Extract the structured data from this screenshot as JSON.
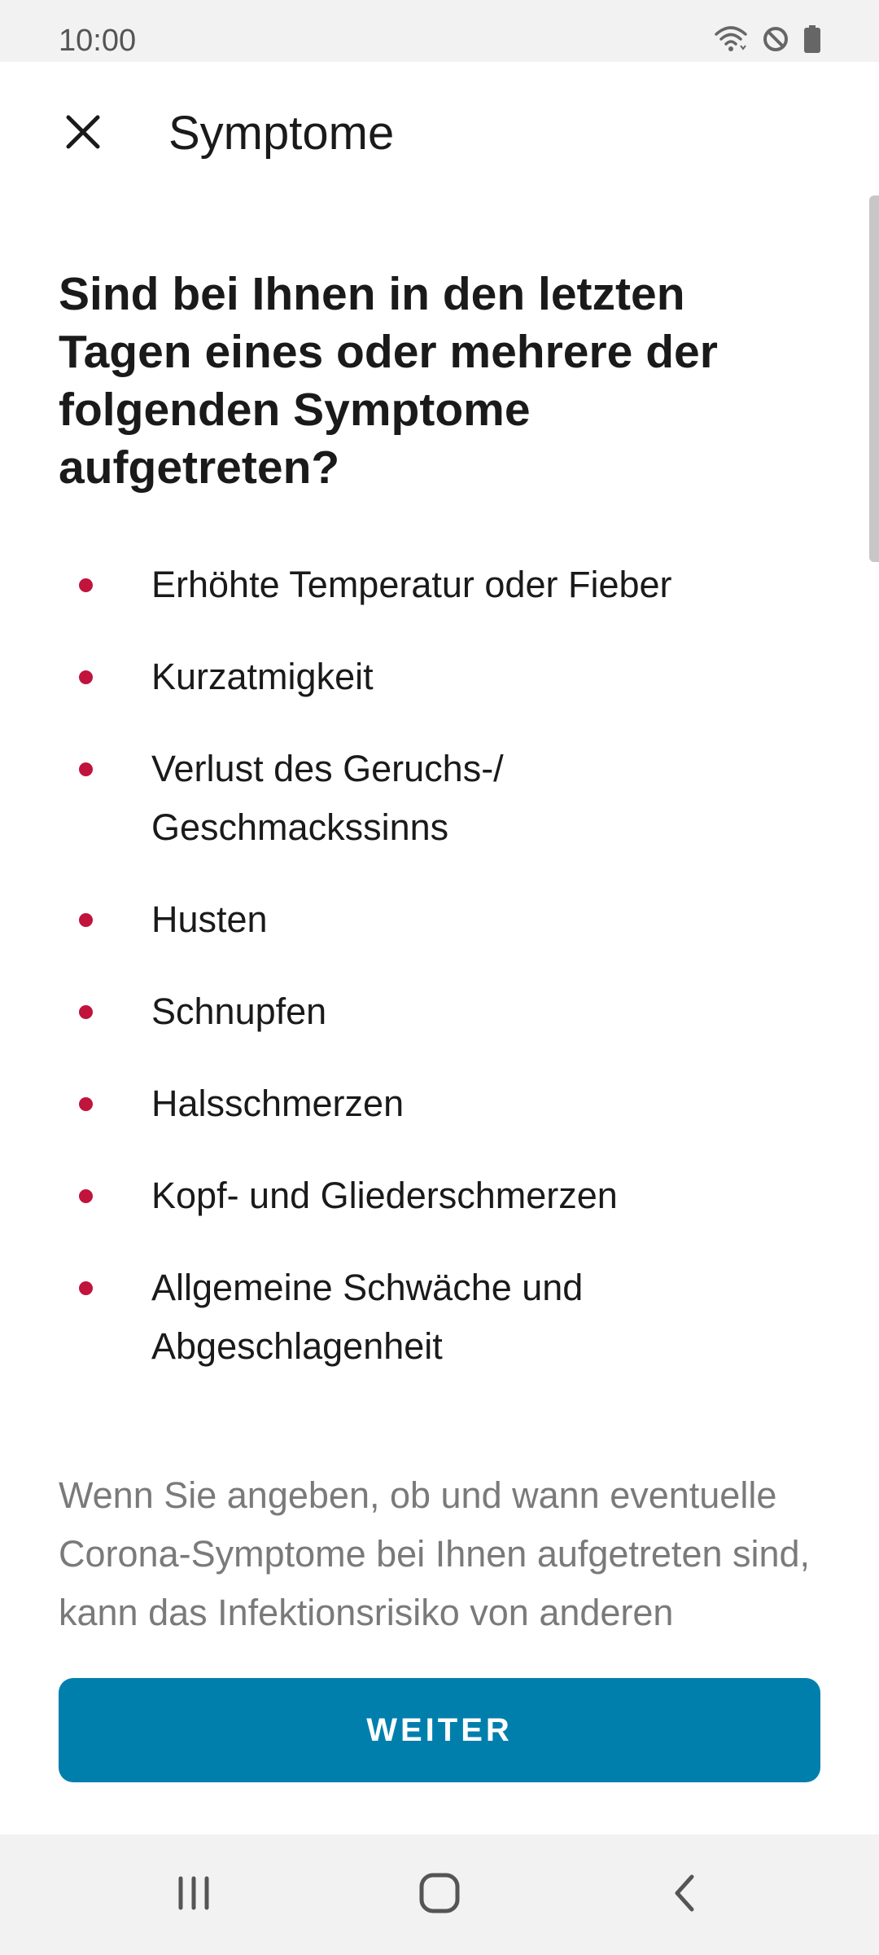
{
  "status_bar": {
    "time": "10:00",
    "icons": [
      "wifi-icon",
      "do-not-disturb-icon",
      "battery-icon"
    ]
  },
  "app_bar": {
    "title": "Symptome",
    "close_icon": "close-icon"
  },
  "main": {
    "question": "Sind bei Ihnen in den letzten Tagen eines oder mehrere der folgenden Symptome aufgetreten?",
    "symptoms": [
      "Erhöhte Temperatur oder Fieber",
      "Kurzatmigkeit",
      "Verlust des Geruchs-/ Geschmackssinns",
      "Husten",
      "Schnupfen",
      "Halsschmerzen",
      "Kopf- und Gliederschmerzen",
      "Allgemeine Schwäche und Abgeschlagenheit"
    ],
    "info_text": "Wenn Sie angeben, ob und wann eventuelle Corona-Symptome bei Ihnen aufgetreten sind, kann das Infektionsrisiko von anderen"
  },
  "footer": {
    "continue_label": "WEITER"
  },
  "nav_bar": {
    "icons": [
      "recent-apps-icon",
      "home-icon",
      "back-icon"
    ]
  },
  "colors": {
    "accent": "#007fad",
    "bullet": "#c0143c",
    "status_bar_bg": "#f2f2f2"
  }
}
